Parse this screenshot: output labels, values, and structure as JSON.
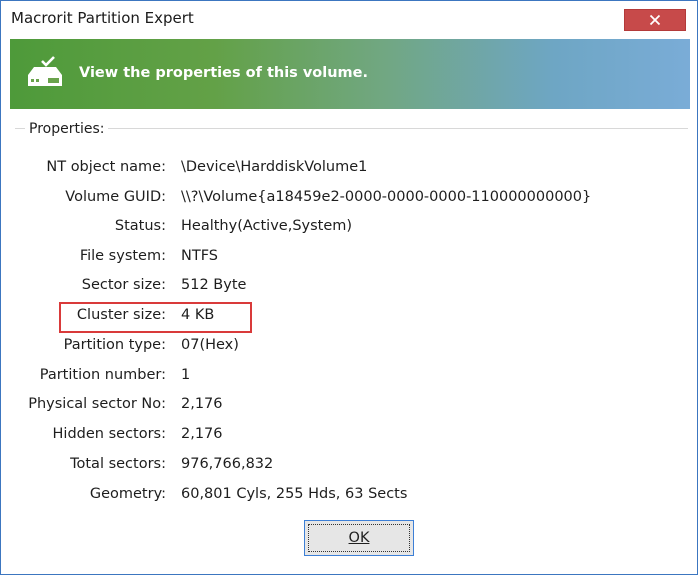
{
  "window": {
    "title": "Macrorit Partition Expert"
  },
  "banner": {
    "text": "View the properties of this volume."
  },
  "properties": {
    "group_label": "Properties:",
    "rows": [
      {
        "label": "NT object name:",
        "value": "\\Device\\HarddiskVolume1"
      },
      {
        "label": "Volume GUID:",
        "value": "\\\\?\\Volume{a18459e2-0000-0000-0000-110000000000}"
      },
      {
        "label": "Status:",
        "value": "Healthy(Active,System)"
      },
      {
        "label": "File system:",
        "value": "NTFS"
      },
      {
        "label": "Sector size:",
        "value": "512 Byte"
      },
      {
        "label": "Cluster size:",
        "value": "4 KB"
      },
      {
        "label": "Partition type:",
        "value": "07(Hex)"
      },
      {
        "label": "Partition number:",
        "value": "1"
      },
      {
        "label": "Physical sector No:",
        "value": "2,176"
      },
      {
        "label": "Hidden sectors:",
        "value": "2,176"
      },
      {
        "label": "Total sectors:",
        "value": "976,766,832"
      },
      {
        "label": "Geometry:",
        "value": "60,801 Cyls, 255 Hds, 63 Sects"
      }
    ]
  },
  "buttons": {
    "ok_label": "OK"
  },
  "colors": {
    "highlight": "#d93a3a",
    "close_button": "#c74a4a",
    "banner_start": "#4e9a3a",
    "banner_end": "#7aacd7"
  },
  "icons": {
    "banner": "hard-drive-check-icon",
    "close": "close-icon"
  }
}
